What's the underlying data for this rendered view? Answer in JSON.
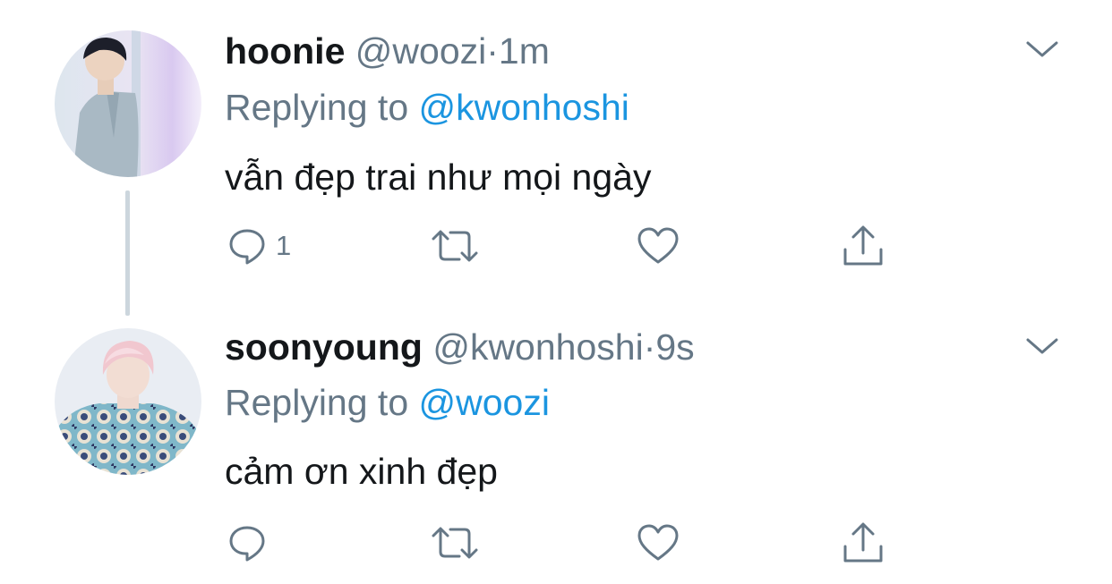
{
  "colors": {
    "text_primary": "#14171a",
    "text_secondary": "#657786",
    "link": "#1b95e0",
    "thread_line": "#ccd6dd"
  },
  "tweets": [
    {
      "display_name": "hoonie",
      "handle": "@woozi",
      "separator": "·",
      "time": "1m",
      "replying_prefix": "Replying to ",
      "replying_to": "@kwonhoshi",
      "text": "vẫn đẹp trai như mọi ngày",
      "reply_count": "1",
      "icons": [
        "chevron-down-icon",
        "reply-icon",
        "retweet-icon",
        "like-icon",
        "share-icon"
      ]
    },
    {
      "display_name": "soonyoung",
      "handle": "@kwonhoshi",
      "separator": "·",
      "time": "9s",
      "replying_prefix": "Replying to ",
      "replying_to": "@woozi",
      "text": "cảm ơn xinh đẹp",
      "reply_count": "",
      "icons": [
        "chevron-down-icon",
        "reply-icon",
        "retweet-icon",
        "like-icon",
        "share-icon"
      ]
    }
  ]
}
